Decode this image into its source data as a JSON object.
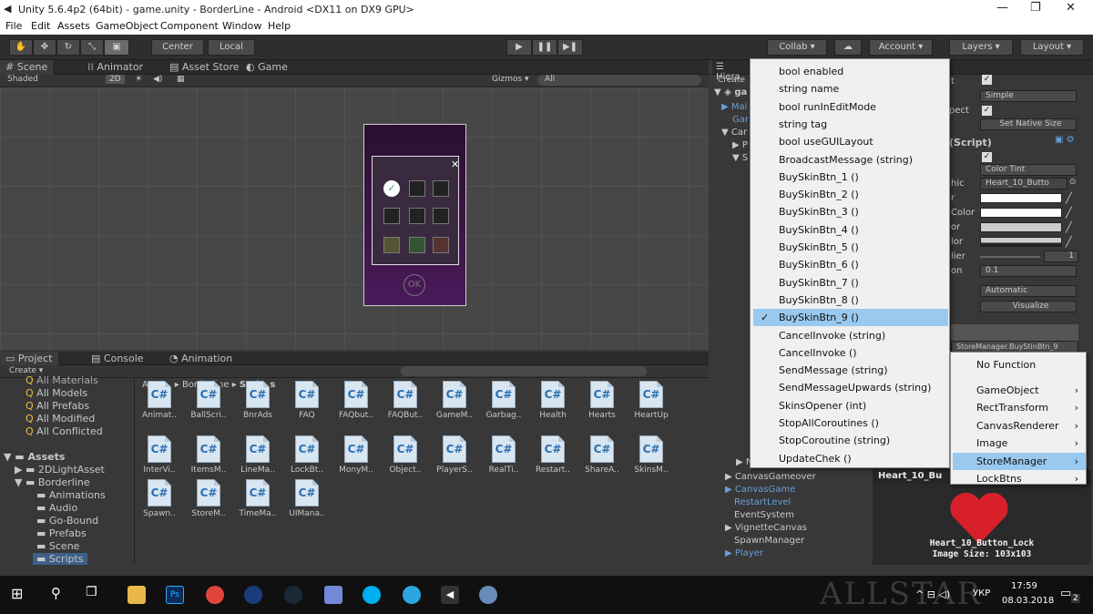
{
  "window": {
    "title": "Unity 5.6.4p2 (64bit) - game.unity - BorderLine - Android <DX11 on DX9 GPU>",
    "minimize": "—",
    "maximize": "❐",
    "close": "✕"
  },
  "menu": [
    "File",
    "Edit",
    "Assets",
    "GameObject",
    "Component",
    "Window",
    "Help"
  ],
  "toolbar": {
    "center": "Center",
    "local": "Local",
    "collab": "Collab ▾",
    "account": "Account ▾",
    "layers": "Layers ▾",
    "layout": "Layout ▾"
  },
  "scene": {
    "tabs": [
      "Scene",
      "Animator",
      "Asset Store",
      "Game"
    ],
    "shaded": "Shaded",
    "mode2d": "2D",
    "gizmos": "Gizmos ▾",
    "search": "All",
    "ok": "OK"
  },
  "project": {
    "tabs": [
      "Project",
      "Console",
      "Animation"
    ],
    "create": "Create ▾",
    "favorites": [
      "All Materials",
      "All Models",
      "All Prefabs",
      "All Modified",
      "All Conflicted"
    ],
    "folders": [
      "Assets",
      "2DLightAsset",
      "Borderline",
      "Animations",
      "Audio",
      "Go-Bound",
      "Prefabs",
      "Scene",
      "Scripts"
    ],
    "breadcrumb": [
      "Assets",
      "Borderline",
      "Scripts"
    ],
    "row1": [
      "Animat..",
      "BallScri..",
      "BnrAds",
      "FAQ",
      "FAQbut..",
      "FAQBut..",
      "GameM..",
      "Garbag..",
      "Health",
      "Hearts",
      "HeartUp"
    ],
    "row2": [
      "InterVi..",
      "ItemsM..",
      "LineMa..",
      "LockBt..",
      "MonyM..",
      "Object..",
      "PlayerS..",
      "RealTi..",
      "Restart..",
      "ShareA..",
      "SkinsM.."
    ],
    "row3": [
      "Spawn..",
      "StoreM..",
      "TimeMa..",
      "UIMana.."
    ]
  },
  "hierarchy": {
    "tab": "Hiera",
    "create": "Create",
    "items": [
      "ga",
      "Mai",
      "Gar",
      "Car",
      "P",
      "S",
      "N",
      "CanvasGameover",
      "CanvasGame",
      "RestartLevel",
      "EventSystem",
      "VignetteCanvas",
      "SpawnManager",
      "Player"
    ]
  },
  "inspector": {
    "simple": "Simple",
    "aspect": "pect",
    "native": "Set Native Size",
    "script": "(Script)",
    "colortint": "Color Tint",
    "graphic": "hic",
    "graphicVal": "Heart_10_Butto",
    "rows": [
      "r",
      "Color",
      "or",
      "lor",
      "lier",
      "on"
    ],
    "mult": "1",
    "fade": "0.1",
    "automatic": "Automatic",
    "visualize": "Visualize",
    "fnfield": "StoreManager.BuyStinBtn_9",
    "previewTitle": "Heart_10_Bu",
    "previewName": "Heart_10_Button_Lock",
    "imageSize": "Image Size: 103x103"
  },
  "dropdown": {
    "items": [
      "bool enabled",
      "string name",
      "bool runInEditMode",
      "string tag",
      "bool useGUILayout",
      "BroadcastMessage (string)",
      "BuySkinBtn_1 ()",
      "BuySkinBtn_2 ()",
      "BuySkinBtn_3 ()",
      "BuySkinBtn_4 ()",
      "BuySkinBtn_5 ()",
      "BuySkinBtn_6 ()",
      "BuySkinBtn_7 ()",
      "BuySkinBtn_8 ()",
      "BuySkinBtn_9 ()",
      "CancelInvoke (string)",
      "CancelInvoke ()",
      "SendMessage (string)",
      "SendMessageUpwards (string)",
      "SkinsOpener (int)",
      "StopAllCoroutines ()",
      "StopCoroutine (string)",
      "UpdateChek ()"
    ],
    "selected": 14
  },
  "submenu": {
    "items": [
      "No Function",
      "GameObject",
      "RectTransform",
      "CanvasRenderer",
      "Image",
      "StoreManager",
      "LockBtns"
    ],
    "selected": 5
  },
  "taskbar": {
    "lang": "УКР",
    "time": "17:59",
    "date": "08.03.2018",
    "notif": "2",
    "watermark": "ALLSTAR"
  },
  "colors": {
    "accent": "#99c9ef",
    "panel": "#383838"
  }
}
